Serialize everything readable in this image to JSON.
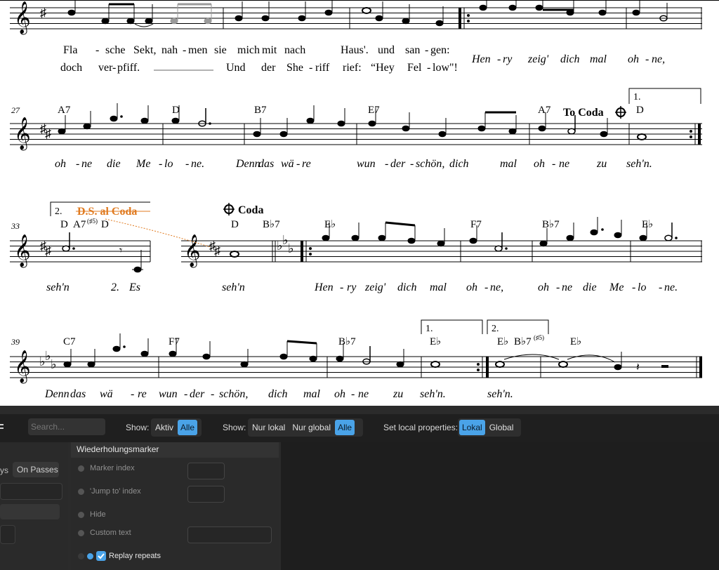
{
  "score": {
    "measure_numbers": [
      "27",
      "33",
      "39"
    ],
    "row1": {
      "lyrics_a": [
        "Fla",
        "-",
        "sche",
        "Sekt,",
        "nah",
        "-",
        "men",
        "sie",
        "mich",
        "mit",
        "nach",
        "Haus'.",
        "und",
        "san",
        "-",
        "gen:"
      ],
      "lyrics_b": [
        "doch",
        "ver",
        "-",
        "pfiff.",
        "Und",
        "der",
        "She",
        "-",
        "riff",
        "rief:",
        "“Hey",
        "Fel",
        "-",
        "low\"!"
      ],
      "lyrics_c": [
        "Hen",
        "-",
        "ry",
        "zeig'",
        "dich",
        "mal",
        "oh",
        "-",
        "ne,"
      ]
    },
    "row2": {
      "chords": [
        "A7",
        "D",
        "B7",
        "E7",
        "A7",
        "D"
      ],
      "to_coda": "To Coda",
      "volta1": "1.",
      "lyrics": [
        "oh",
        "-",
        "ne",
        "die",
        "Me",
        "-",
        "lo",
        "-",
        "ne.",
        "Denn",
        "das",
        "wä",
        "-",
        "re",
        "wun",
        "-",
        "der",
        "-",
        "schön,",
        "dich",
        "mal",
        "oh",
        "-",
        "ne",
        "zu",
        "seh'n."
      ]
    },
    "row3": {
      "volta2": "2.",
      "ds_al_coda": "D.S. al Coda",
      "coda_label": "Coda",
      "chord_a7": "A7",
      "chord_a7_sup": "(♯5)",
      "chords": [
        "D",
        "D",
        "D",
        "B♭7",
        "E♭",
        "F7",
        "B♭7",
        "E♭"
      ],
      "lyrics": [
        "seh'n",
        "2.",
        "Es",
        "seh'n",
        "Hen",
        "-",
        "ry",
        "zeig'",
        "dich",
        "mal",
        "oh",
        "-",
        "ne,",
        "oh",
        "-",
        "ne",
        "die",
        "Me",
        "-",
        "lo",
        "-",
        "ne."
      ]
    },
    "row4": {
      "chords": [
        "C7",
        "F7",
        "B♭7",
        "E♭",
        "E♭",
        "B♭7",
        "E♭"
      ],
      "chord_sup": "(♯5)",
      "volta1": "1.",
      "volta2": "2.",
      "lyrics": [
        "Denn",
        "das",
        "wä",
        "-",
        "re",
        "wun",
        "-",
        "der",
        "-",
        "schön,",
        "dich",
        "mal",
        "oh",
        "-",
        "ne",
        "zu",
        "seh'n.",
        "seh'n."
      ]
    }
  },
  "toolbar": {
    "search_placeholder": "Search...",
    "show_label_1": "Show:",
    "show_options_1": [
      "Aktiv",
      "Alle"
    ],
    "show_label_2": "Show:",
    "show_options_2": [
      "Nur lokal",
      "Nur global",
      "Alle"
    ],
    "local_label": "Set local properties:",
    "local_options": [
      "Lokal",
      "Global"
    ]
  },
  "left_panel": {
    "tab_partial": "ys",
    "tab_on_passes": "On Passes"
  },
  "properties_panel": {
    "title": "Wiederholungsmarker",
    "marker_index": "Marker index",
    "jump_to_index": "'Jump to' index",
    "hide": "Hide",
    "custom_text": "Custom text",
    "replay_repeats": "Replay repeats",
    "replay_repeats_checked": true
  },
  "colors": {
    "accent": "#4aa3e8",
    "ds_orange": "#e07a1f",
    "panel_bg": "#2a2a2a"
  }
}
